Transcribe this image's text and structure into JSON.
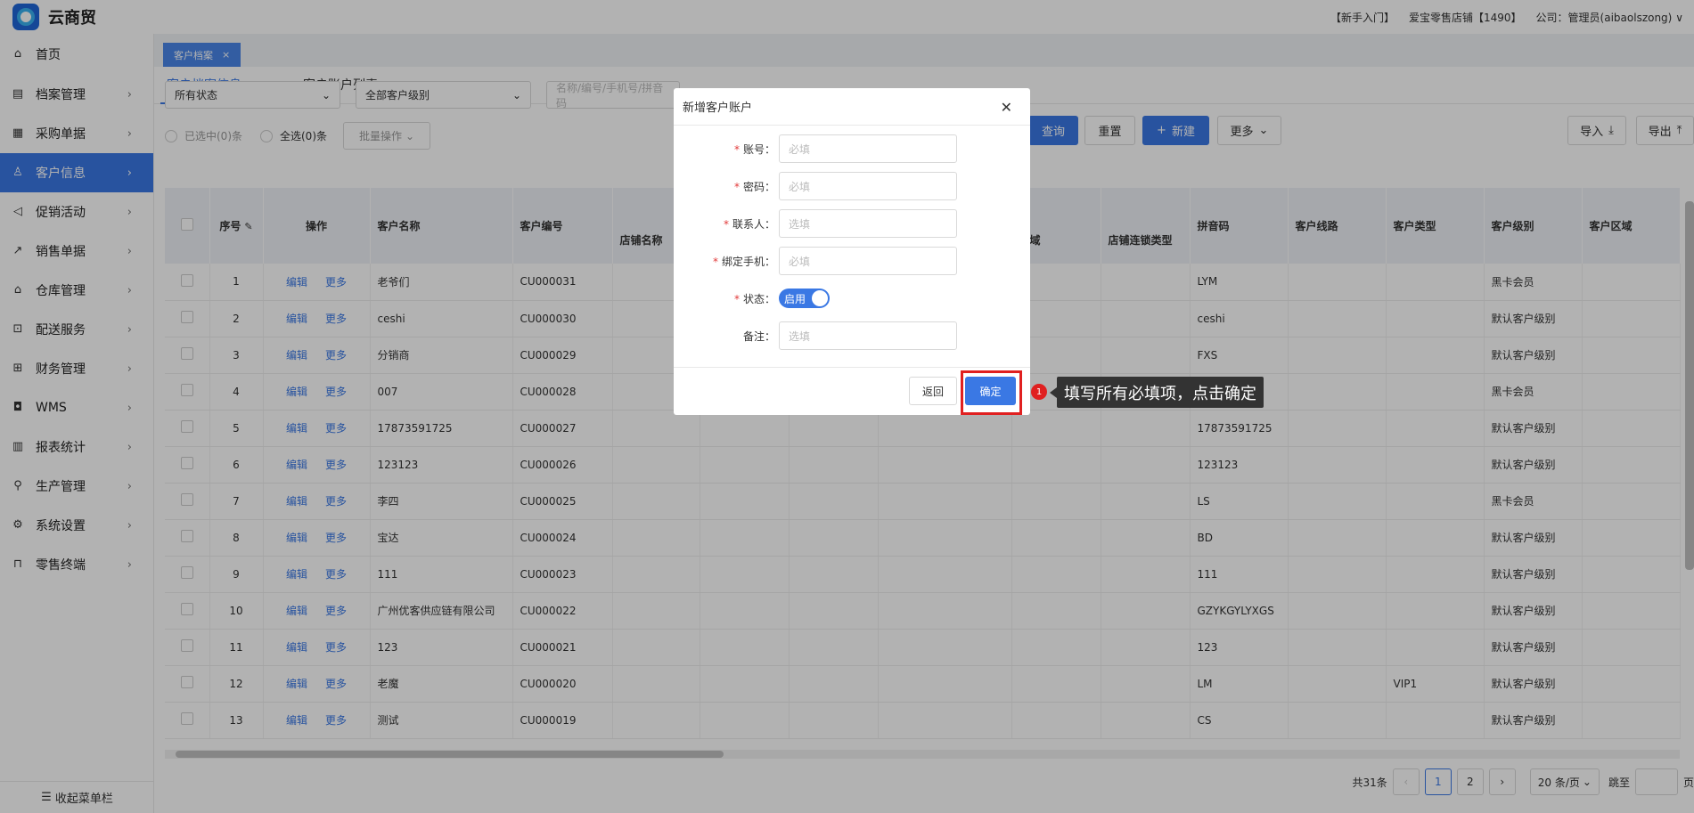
{
  "app": {
    "name": "云商贸"
  },
  "header": {
    "guide": "【新手入门】",
    "store": "爱宝零售店铺【1490】",
    "company": "公司：管理员(aibaolszong)",
    "chevron": "∨"
  },
  "sidebar": {
    "items": [
      {
        "label": "首页",
        "icon": "home-icon"
      },
      {
        "label": "档案管理",
        "icon": "archive-icon"
      },
      {
        "label": "采购单据",
        "icon": "purchase-icon"
      },
      {
        "label": "客户信息",
        "icon": "user-icon",
        "active": true
      },
      {
        "label": "促销活动",
        "icon": "megaphone-icon"
      },
      {
        "label": "销售单据",
        "icon": "chart-line-icon"
      },
      {
        "label": "仓库管理",
        "icon": "warehouse-icon"
      },
      {
        "label": "配送服务",
        "icon": "cart-icon"
      },
      {
        "label": "财务管理",
        "icon": "finance-icon"
      },
      {
        "label": "WMS",
        "icon": "car-icon"
      },
      {
        "label": "报表统计",
        "icon": "bar-chart-icon"
      },
      {
        "label": "生产管理",
        "icon": "network-icon"
      },
      {
        "label": "系统设置",
        "icon": "gear-icon"
      },
      {
        "label": "零售终端",
        "icon": "bag-icon"
      }
    ],
    "collapse_label": "收起菜单栏"
  },
  "tabs": {
    "open": "客户档案",
    "sub": [
      "客户档案信息",
      "客户账户列表"
    ]
  },
  "filters": {
    "status": "所有状态",
    "level": "全部客户级别",
    "search_placeholder": "名称/编号/手机号/拼音码",
    "query": "查询",
    "reset": "重置",
    "new": "新建",
    "more": "更多",
    "import": "导入",
    "export": "导出"
  },
  "selection": {
    "selected": "已选中(0)条",
    "all": "全选(0)条",
    "batch": "批量操作"
  },
  "table": {
    "headers": {
      "index": "序号",
      "ops": "操作",
      "name": "客户名称",
      "code": "客户编号",
      "store": "店铺名称",
      "region": "区域",
      "chain": "店铺连锁类型",
      "pinyin": "拼音码",
      "route": "客户线路",
      "type": "客户类型",
      "level": "客户级别",
      "area": "客户区域"
    },
    "edit": "编辑",
    "more": "更多",
    "rows": [
      {
        "no": "1",
        "name": "老爷们",
        "code": "CU000031",
        "pinyin": "LYM",
        "type": "",
        "level": "黑卡会员"
      },
      {
        "no": "2",
        "name": "ceshi",
        "code": "CU000030",
        "pinyin": "ceshi",
        "type": "",
        "level": "默认客户级别"
      },
      {
        "no": "3",
        "name": "分销商",
        "code": "CU000029",
        "pinyin": "FXS",
        "type": "",
        "level": "默认客户级别"
      },
      {
        "no": "4",
        "name": "007",
        "code": "CU000028",
        "pinyin": "",
        "type": "",
        "level": "黑卡会员"
      },
      {
        "no": "5",
        "name": "17873591725",
        "code": "CU000027",
        "pinyin": "17873591725",
        "type": "",
        "level": "默认客户级别"
      },
      {
        "no": "6",
        "name": "123123",
        "code": "CU000026",
        "pinyin": "123123",
        "type": "",
        "level": "默认客户级别"
      },
      {
        "no": "7",
        "name": "李四",
        "code": "CU000025",
        "pinyin": "LS",
        "type": "",
        "level": "黑卡会员"
      },
      {
        "no": "8",
        "name": "宝达",
        "code": "CU000024",
        "pinyin": "BD",
        "type": "",
        "level": "默认客户级别"
      },
      {
        "no": "9",
        "name": "111",
        "code": "CU000023",
        "pinyin": "111",
        "type": "",
        "level": "默认客户级别"
      },
      {
        "no": "10",
        "name": "广州优客供应链有限公司",
        "code": "CU000022",
        "pinyin": "GZYKGYLYXGS",
        "type": "",
        "level": "默认客户级别"
      },
      {
        "no": "11",
        "name": "123",
        "code": "CU000021",
        "pinyin": "123",
        "type": "",
        "level": "默认客户级别"
      },
      {
        "no": "12",
        "name": "老魔",
        "code": "CU000020",
        "pinyin": "LM",
        "type": "VIP1",
        "level": "默认客户级别"
      },
      {
        "no": "13",
        "name": "测试",
        "code": "CU000019",
        "pinyin": "CS",
        "type": "",
        "level": "默认客户级别"
      }
    ]
  },
  "pagination": {
    "total": "共31条",
    "pages": [
      "1",
      "2"
    ],
    "page_size": "20 条/页",
    "jump": "跳至",
    "page_unit": "页"
  },
  "modal": {
    "title": "新增客户账户",
    "fields": [
      {
        "label": "账号：",
        "placeholder": "必填",
        "required": true
      },
      {
        "label": "密码：",
        "placeholder": "必填",
        "required": true
      },
      {
        "label": "联系人：",
        "placeholder": "选填",
        "required": true
      },
      {
        "label": "绑定手机：",
        "placeholder": "必填",
        "required": true
      }
    ],
    "status_label": "状态：",
    "status_value": "启用",
    "remark_label": "备注：",
    "remark_placeholder": "选填",
    "back": "返回",
    "confirm": "确定"
  },
  "tooltip": {
    "step": "1",
    "text": "填写所有必填项，点击确定"
  }
}
